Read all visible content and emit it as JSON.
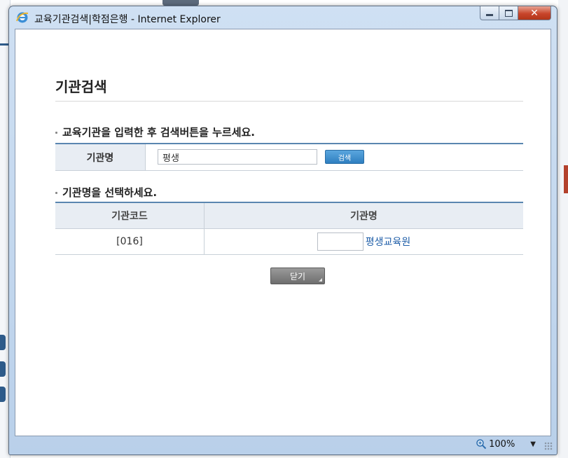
{
  "window": {
    "title": "교육기관검색|학점은행 - Internet Explorer"
  },
  "page": {
    "title": "기관검색",
    "instruction_search": "교육기관을 입력한 후 검색버튼을 누르세요.",
    "instruction_select": "기관명을 선택하세요."
  },
  "search": {
    "label": "기관명",
    "value": "평생",
    "button_label": "검색"
  },
  "results": {
    "headers": [
      "기관코드",
      "기관명"
    ],
    "rows": [
      {
        "code": "[016]",
        "name": "평생교육원"
      }
    ]
  },
  "close_button": {
    "label": "닫기"
  },
  "statusbar": {
    "zoom": "100%"
  },
  "colors": {
    "accent_border": "#5a86b0",
    "header_bg": "#e8edf3",
    "link": "#1f5ea8",
    "search_button": "#2f7fc0"
  }
}
